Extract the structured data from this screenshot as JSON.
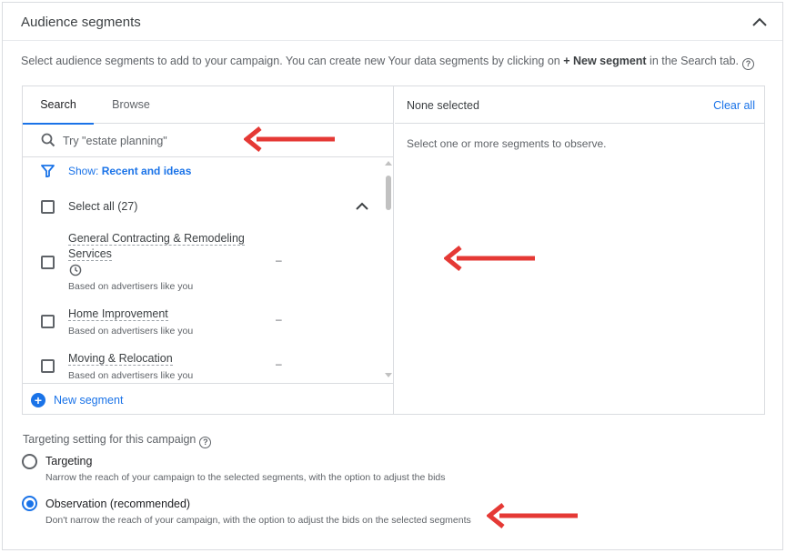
{
  "header": {
    "title": "Audience segments"
  },
  "description": {
    "before": "Select audience segments to add to your campaign. You can create new Your data segments by clicking on ",
    "bold": "+ New segment",
    "after": " in the Search tab."
  },
  "tabs": [
    {
      "label": "Search",
      "active": true
    },
    {
      "label": "Browse",
      "active": false
    }
  ],
  "search": {
    "placeholder": "Try \"estate planning\"",
    "value": ""
  },
  "filter": {
    "prefix": "Show: ",
    "value": "Recent and ideas"
  },
  "select_all": {
    "label": "Select all (27)"
  },
  "items": [
    {
      "line1": "General Contracting & Remodeling",
      "line2": "Services",
      "sub": "Based on advertisers like you",
      "metric": "–"
    },
    {
      "line1": "Home Improvement",
      "sub": "Based on advertisers like you",
      "metric": "–"
    },
    {
      "line1": "Moving & Relocation",
      "sub": "Based on advertisers like you",
      "metric": "–"
    }
  ],
  "new_segment": {
    "label": "New segment"
  },
  "right_panel": {
    "title": "None selected",
    "clear_all": "Clear all",
    "empty": "Select one or more segments to observe."
  },
  "targeting": {
    "title": "Targeting setting for this campaign",
    "options": [
      {
        "label": "Targeting",
        "desc": "Narrow the reach of your campaign to the selected segments, with the option to adjust the bids",
        "checked": false
      },
      {
        "label": "Observation (recommended)",
        "desc": "Don't narrow the reach of your campaign, with the option to adjust the bids on the selected segments",
        "checked": true
      }
    ]
  },
  "colors": {
    "accent": "#1a73e8",
    "annotation_arrow": "#e53935",
    "border": "#dadce0",
    "muted_text": "#5f6368"
  },
  "icons": [
    "chevron-up-icon",
    "help-icon",
    "search-icon",
    "filter-icon",
    "clock-icon",
    "plus-circle-icon",
    "annotation-arrow-icon"
  ]
}
